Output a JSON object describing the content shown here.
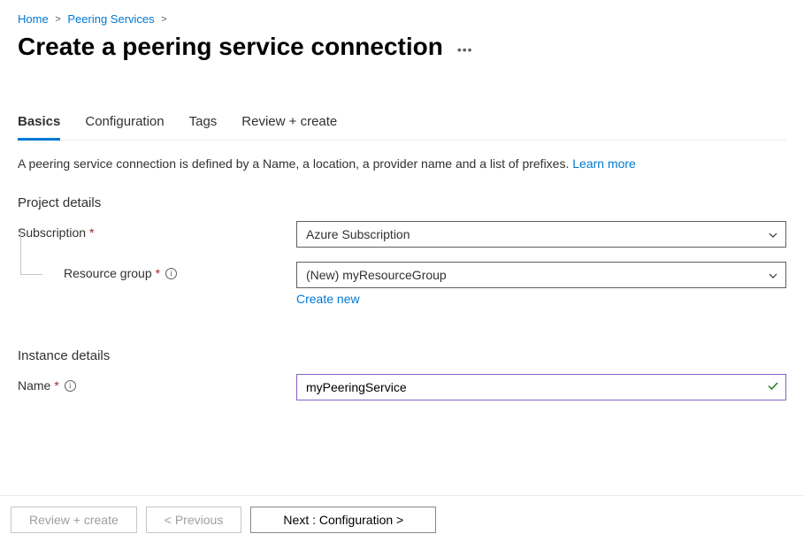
{
  "breadcrumb": {
    "home": "Home",
    "peering": "Peering Services"
  },
  "page_title": "Create a peering service connection",
  "tabs": {
    "basics": "Basics",
    "configuration": "Configuration",
    "tags": "Tags",
    "review": "Review + create"
  },
  "description": {
    "text": "A peering service connection is defined by a Name, a location, a provider name and a list of prefixes. ",
    "link": "Learn more"
  },
  "sections": {
    "project_details": "Project details",
    "instance_details": "Instance details"
  },
  "fields": {
    "subscription_label": "Subscription",
    "subscription_value": "Azure Subscription",
    "resource_group_label": "Resource group",
    "resource_group_value": "(New) myResourceGroup",
    "create_new": "Create new",
    "name_label": "Name",
    "name_value": "myPeeringService"
  },
  "footer": {
    "review": "Review + create",
    "previous": "< Previous",
    "next": "Next : Configuration >"
  }
}
